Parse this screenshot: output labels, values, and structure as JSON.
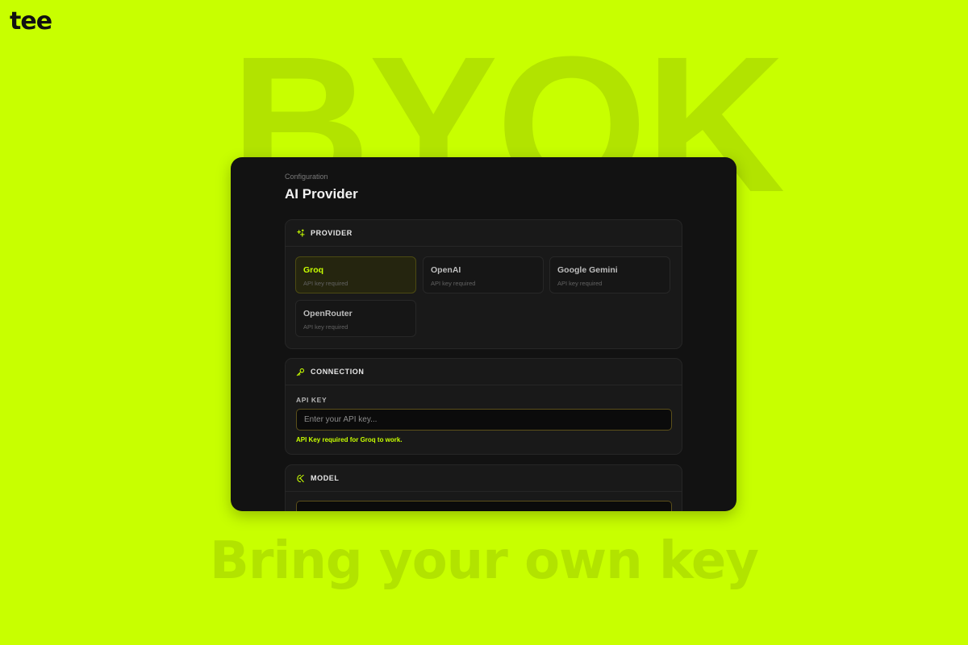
{
  "brand": {
    "logo_text": "tee"
  },
  "background": {
    "headline": "BYOK",
    "tagline": "Bring your own key"
  },
  "colors": {
    "accent": "#c8ff00",
    "panel": "#121212",
    "card": "#191919"
  },
  "config": {
    "breadcrumb": "Configuration",
    "title": "AI Provider",
    "provider_section": {
      "label": "PROVIDER",
      "icon": "sparkles-icon",
      "options": [
        {
          "name": "Groq",
          "sub": "API key required",
          "selected": true
        },
        {
          "name": "OpenAI",
          "sub": "API key required",
          "selected": false
        },
        {
          "name": "Google Gemini",
          "sub": "API key required",
          "selected": false
        },
        {
          "name": "OpenRouter",
          "sub": "API key required",
          "selected": false
        }
      ]
    },
    "connection_section": {
      "label": "CONNECTION",
      "icon": "key-icon",
      "field_label": "API KEY",
      "placeholder": "Enter your API key...",
      "value": "",
      "hint": "API Key required for Groq to work."
    },
    "model_section": {
      "label": "MODEL",
      "icon": "cpu-icon"
    }
  }
}
